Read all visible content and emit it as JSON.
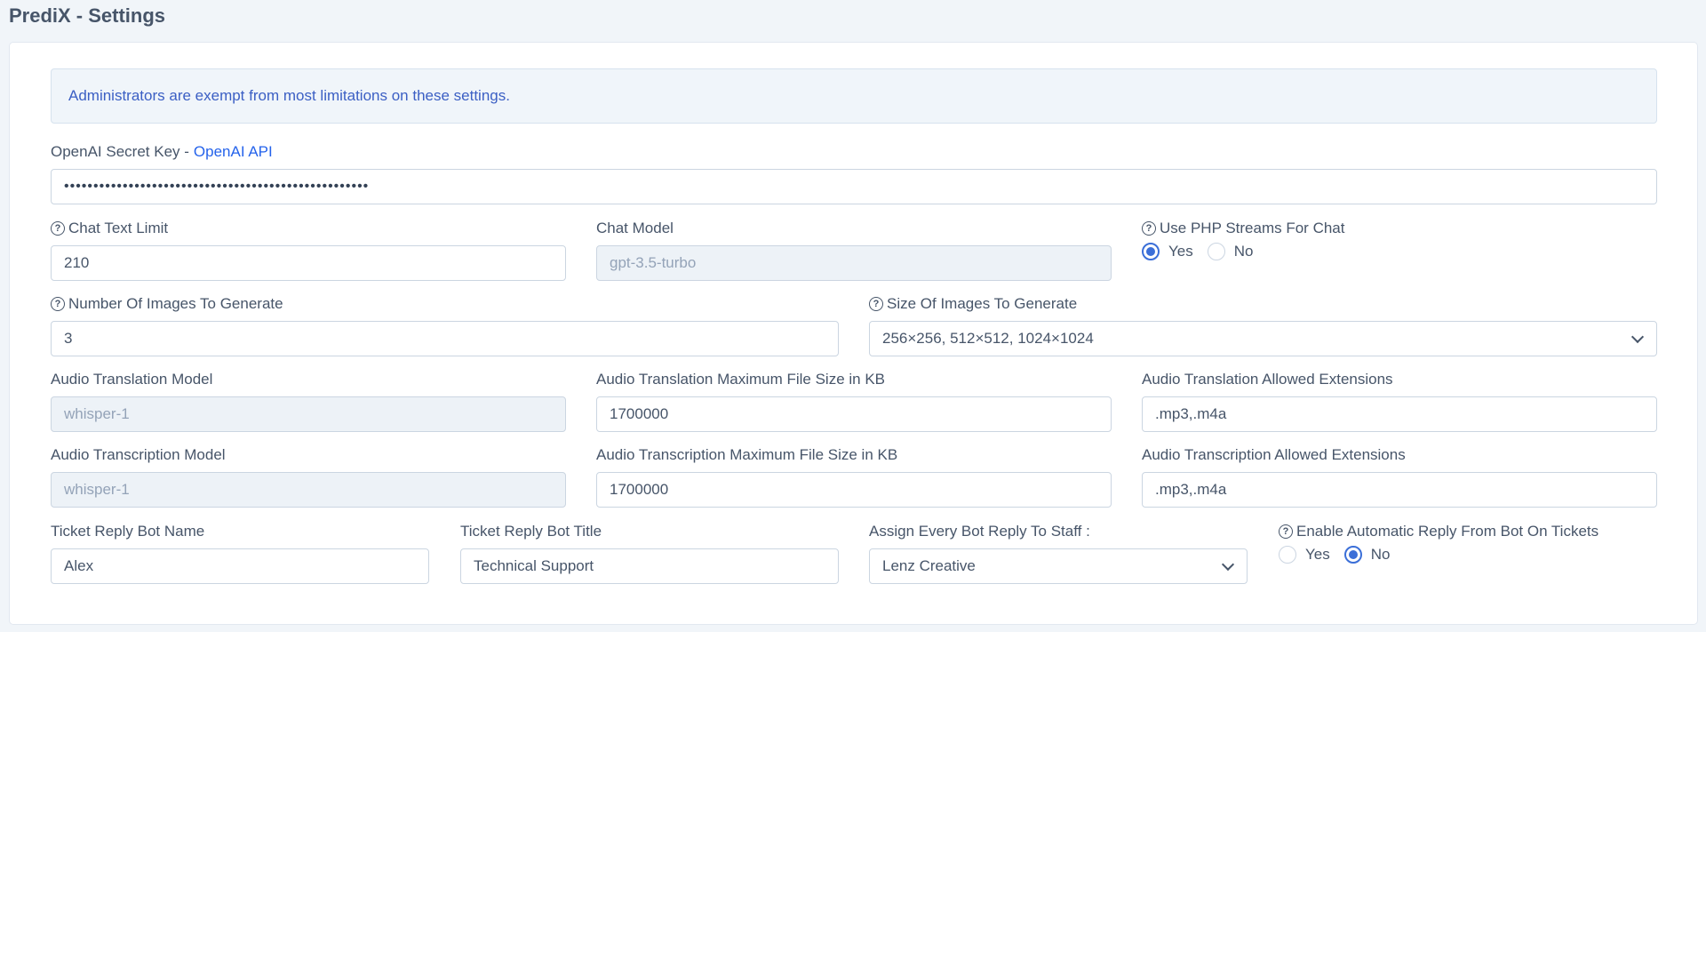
{
  "page": {
    "title": "PrediX - Settings"
  },
  "alert": {
    "text": "Administrators are exempt from most limitations on these settings."
  },
  "openai_key": {
    "label": "OpenAI Secret Key -",
    "link": "OpenAI API",
    "value": "••••••••••••••••••••••••••••••••••••••••••••••••••••"
  },
  "chat_text_limit": {
    "label": "Chat Text Limit",
    "value": "210"
  },
  "chat_model": {
    "label": "Chat Model",
    "value": "gpt-3.5-turbo"
  },
  "php_streams": {
    "label": "Use PHP Streams For Chat",
    "yes": "Yes",
    "no": "No",
    "selected": "Yes"
  },
  "num_images": {
    "label": "Number Of Images To Generate",
    "value": "3"
  },
  "image_size": {
    "label": "Size Of Images To Generate",
    "value": "256×256, 512×512, 1024×1024"
  },
  "audio_translation_model": {
    "label": "Audio Translation Model",
    "value": "whisper-1"
  },
  "audio_translation_max": {
    "label": "Audio Translation Maximum File Size in KB",
    "value": "1700000"
  },
  "audio_translation_ext": {
    "label": "Audio Translation Allowed Extensions",
    "value": ".mp3,.m4a"
  },
  "audio_transcription_model": {
    "label": "Audio Transcription Model",
    "value": "whisper-1"
  },
  "audio_transcription_max": {
    "label": "Audio Transcription Maximum File Size in KB",
    "value": "1700000"
  },
  "audio_transcription_ext": {
    "label": "Audio Transcription Allowed Extensions",
    "value": ".mp3,.m4a"
  },
  "bot_name": {
    "label": "Ticket Reply Bot Name",
    "value": "Alex"
  },
  "bot_title": {
    "label": "Ticket Reply Bot Title",
    "value": "Technical Support"
  },
  "assign_staff": {
    "label": "Assign Every Bot Reply To Staff :",
    "value": "Lenz Creative"
  },
  "auto_reply": {
    "label": "Enable Automatic Reply From Bot On Tickets",
    "yes": "Yes",
    "no": "No",
    "selected": "No"
  },
  "icons": {
    "help": "question-circle-icon",
    "dropdown": "chevron-down-icon"
  },
  "colors": {
    "accent": "#3b6fd8",
    "link": "#2563eb",
    "alert_text": "#3b5fc4",
    "background": "#f1f5f9"
  }
}
